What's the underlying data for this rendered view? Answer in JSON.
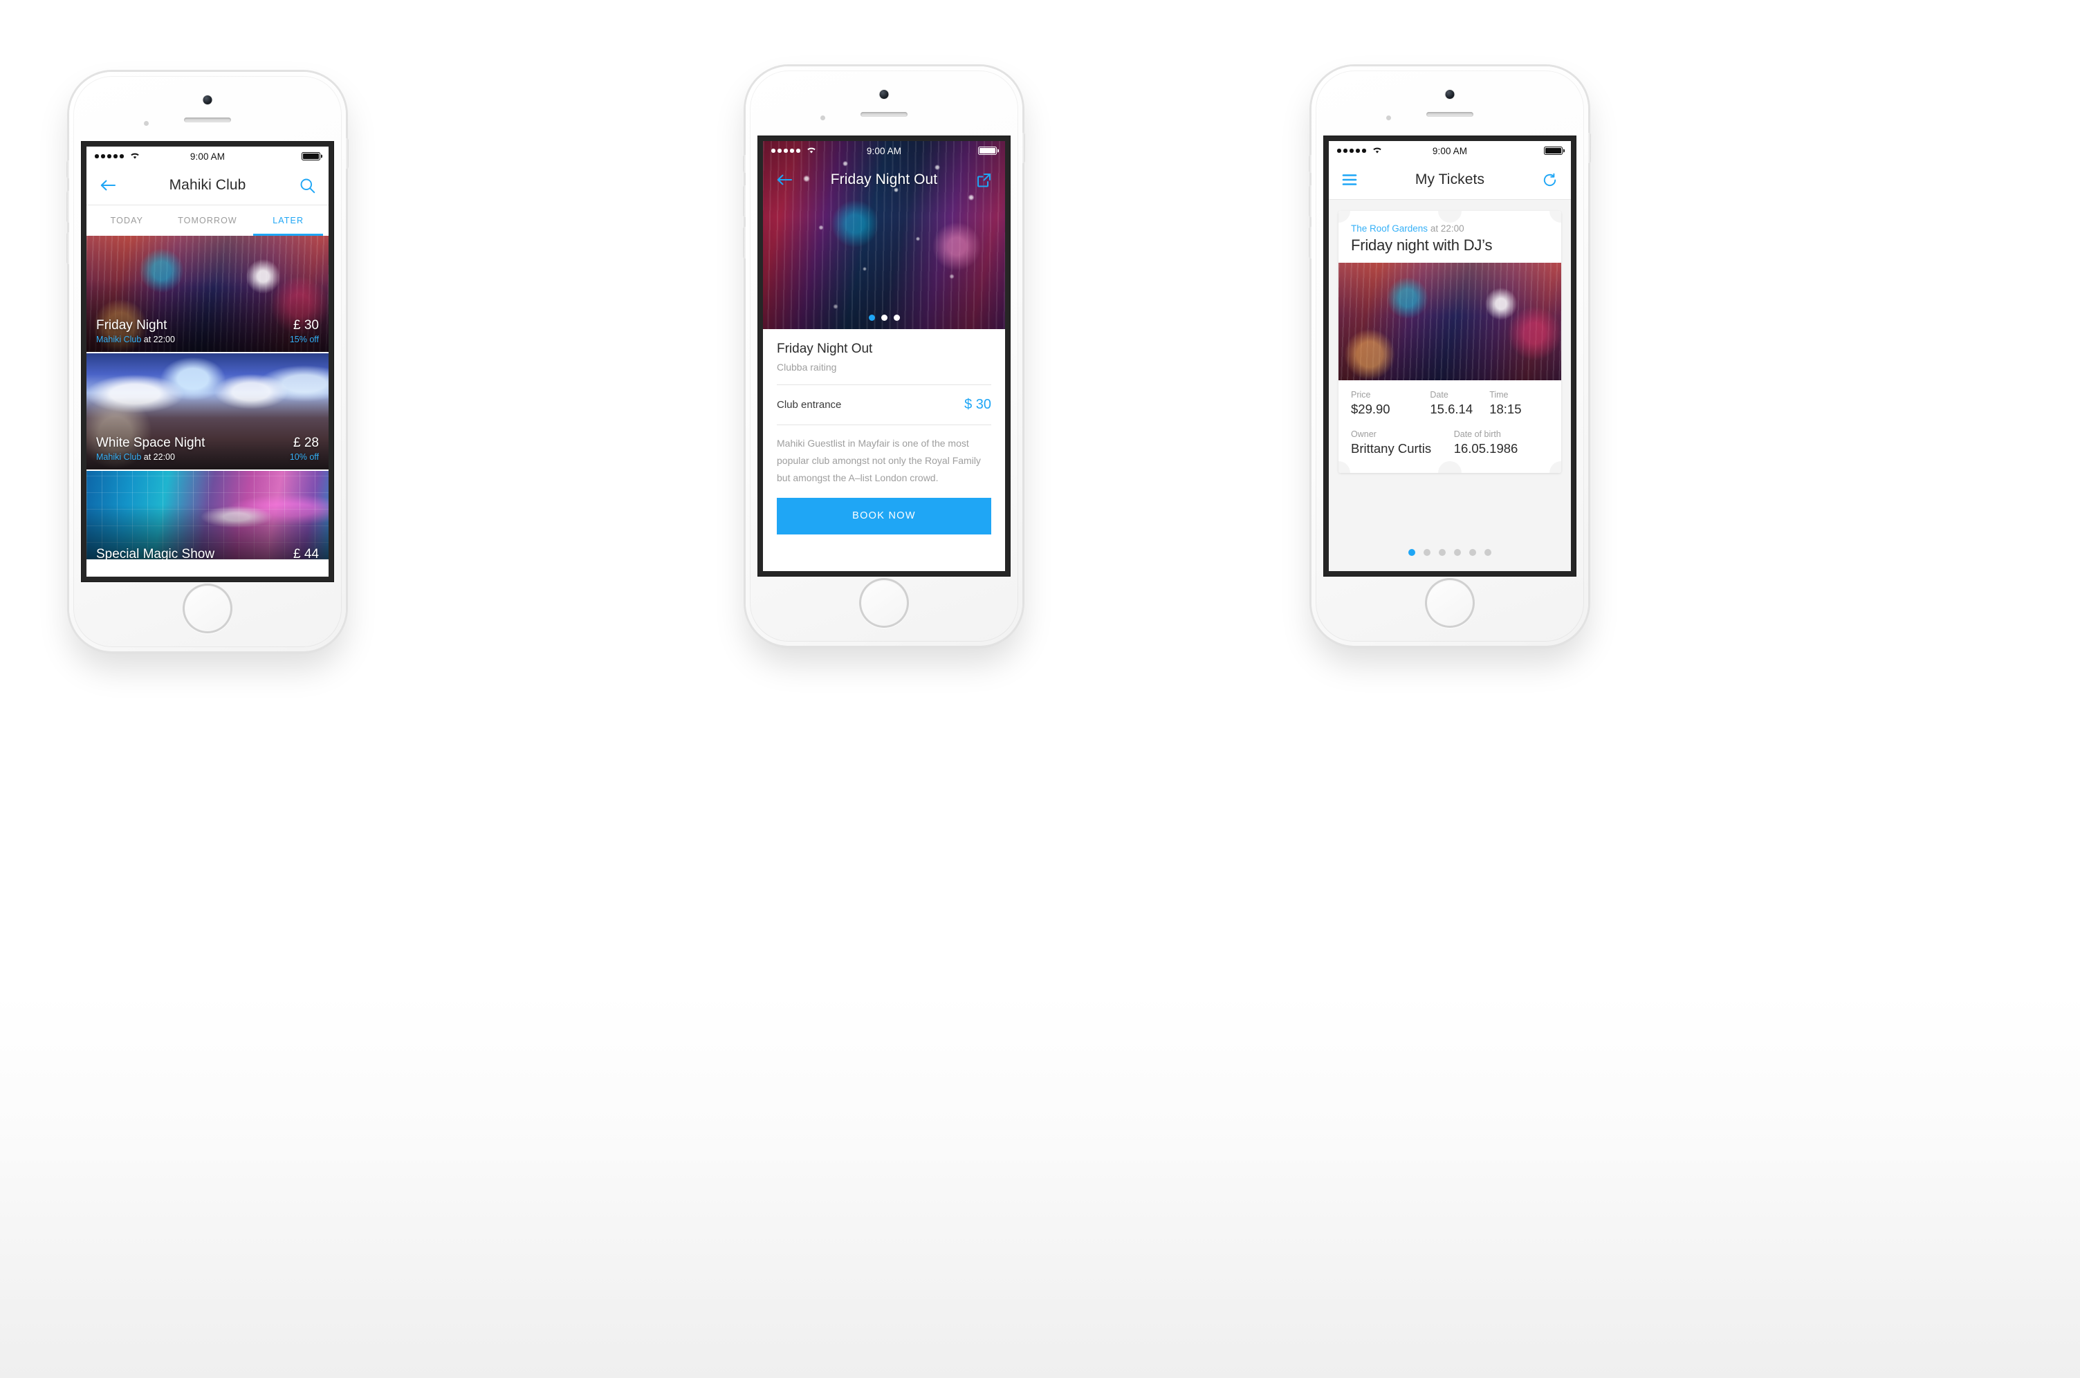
{
  "accent": "#1fa6f5",
  "status_bar": {
    "time": "9:00 AM",
    "signal_dots": 5
  },
  "phones": [
    {
      "id": "phone-events-list",
      "nav": {
        "title": "Mahiki Club",
        "back_icon": "arrow-left-icon",
        "action_icon": "search-icon"
      },
      "tabs": [
        {
          "label": "TODAY",
          "active": false
        },
        {
          "label": "TOMORROW",
          "active": false
        },
        {
          "label": "LATER",
          "active": true
        }
      ],
      "events": [
        {
          "title": "Friday Night",
          "venue": "Mahiki Club",
          "at": " at 22:00",
          "price": "£ 30",
          "discount": "15% off",
          "art": "ph-crowd"
        },
        {
          "title": "White Space Night",
          "venue": "Mahiki Club",
          "at": " at 22:00",
          "price": "£ 28",
          "discount": "10% off",
          "art": "ph-white"
        },
        {
          "title": "Special Magic Show",
          "venue": "",
          "at": "",
          "price": "£ 44",
          "discount": "",
          "art": "ph-magic"
        }
      ]
    },
    {
      "id": "phone-event-detail",
      "nav": {
        "title": "Friday Night Out",
        "back_icon": "arrow-left-icon",
        "action_icon": "share-external-icon"
      },
      "hero": {
        "art": "ph-confetti",
        "dots": 3,
        "active_dot": 0
      },
      "detail": {
        "title": "Friday Night Out",
        "subtitle": "Clubba raiting",
        "price_label": "Club entrance",
        "price_value": "$ 30",
        "description": "Mahiki Guestlist in Mayfair is one of the most popular club amongst not only the Royal Family but amongst the A–list London crowd.",
        "book_label": "BOOK NOW"
      }
    },
    {
      "id": "phone-my-tickets",
      "nav": {
        "title": "My Tickets",
        "menu_icon": "hamburger-menu-icon",
        "action_icon": "refresh-icon"
      },
      "ticket": {
        "venue": "The Roof Gardens",
        "at": " at 22:00",
        "name": "Friday night with DJ’s",
        "art": "ph-crowd",
        "fields_row1": [
          {
            "key": "Price",
            "value": "$29.90"
          },
          {
            "key": "Date",
            "value": "15.6.14"
          },
          {
            "key": "Time",
            "value": "18:15"
          }
        ],
        "fields_row2": [
          {
            "key": "Owner",
            "value": "Brittany Curtis"
          },
          {
            "key": "Date of birth",
            "value": "16.05.1986"
          }
        ]
      },
      "pager": {
        "dots": 6,
        "active_dot": 0
      }
    }
  ]
}
